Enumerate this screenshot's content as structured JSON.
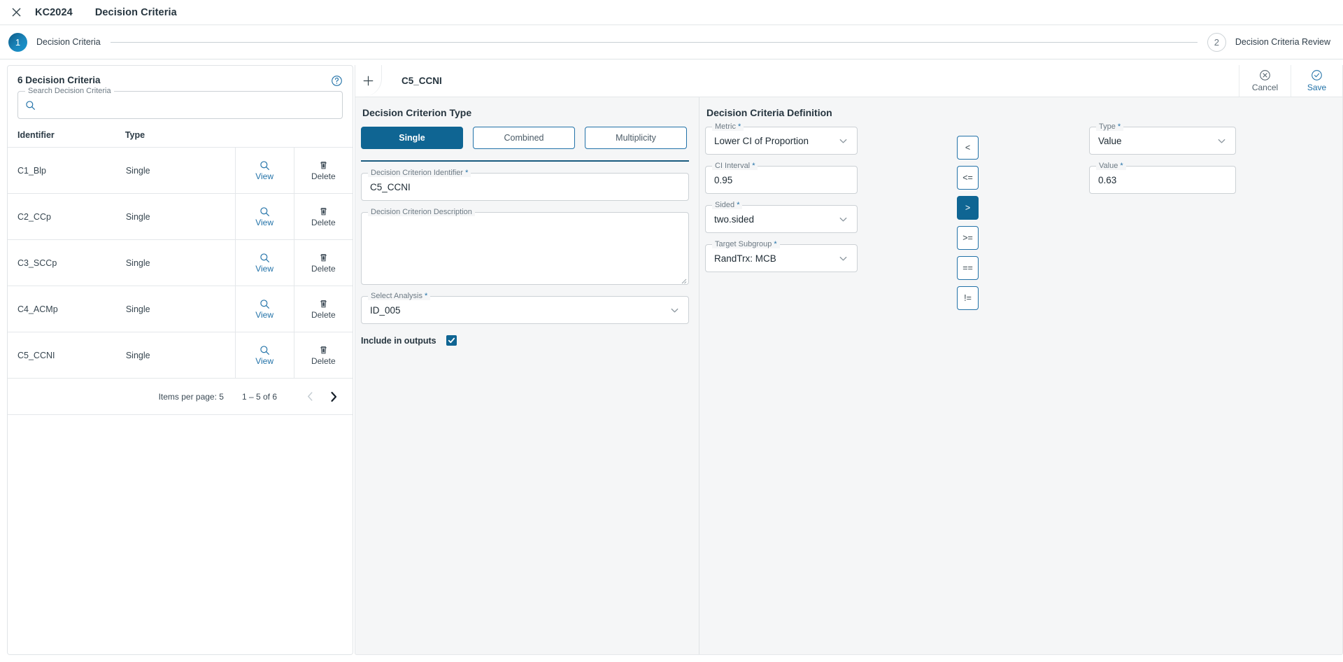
{
  "titlebar": {
    "close_icon": "close-icon",
    "app": "KC2024",
    "page": "Decision Criteria"
  },
  "stepper": {
    "steps": [
      {
        "number": "1",
        "label": "Decision Criteria",
        "active": true
      },
      {
        "number": "2",
        "label": "Decision Criteria Review",
        "active": false
      }
    ]
  },
  "left_panel": {
    "title": "6 Decision Criteria",
    "help_icon": "help-circle-icon",
    "search": {
      "label": "Search Decision Criteria",
      "value": "",
      "icon": "search-icon"
    },
    "columns": [
      "Identifier",
      "Type",
      "",
      ""
    ],
    "rows": [
      {
        "identifier": "C1_Blp",
        "type": "Single",
        "view": "View",
        "delete": "Delete"
      },
      {
        "identifier": "C2_CCp",
        "type": "Single",
        "view": "View",
        "delete": "Delete"
      },
      {
        "identifier": "C3_SCCp",
        "type": "Single",
        "view": "View",
        "delete": "Delete"
      },
      {
        "identifier": "C4_ACMp",
        "type": "Single",
        "view": "View",
        "delete": "Delete"
      },
      {
        "identifier": "C5_CCNI",
        "type": "Single",
        "view": "View",
        "delete": "Delete"
      }
    ],
    "paginator": {
      "items_per_page": "Items per page: 5",
      "range": "1 – 5 of 6",
      "prev_icon": "chevron-left-icon",
      "next_icon": "chevron-right-icon"
    }
  },
  "main": {
    "add_icon": "plus-icon",
    "title": "C5_CCNI",
    "cancel": {
      "label": "Cancel",
      "icon": "cancel-circle-icon"
    },
    "save": {
      "label": "Save",
      "icon": "check-circle-icon"
    },
    "criterion_type": {
      "section_title": "Decision Criterion Type",
      "options": [
        "Single",
        "Combined",
        "Multiplicity"
      ],
      "selected": "Single"
    },
    "identifier_field": {
      "label": "Decision Criterion Identifier",
      "required": "*",
      "value": "C5_CCNI"
    },
    "description_field": {
      "label": "Decision Criterion Description",
      "required": "",
      "value": ""
    },
    "analysis_field": {
      "label": "Select Analysis",
      "required": "*",
      "value": "ID_005"
    },
    "include_outputs": {
      "label": "Include in outputs",
      "checked": true,
      "check_glyph": "✔"
    }
  },
  "definition": {
    "section_title": "Decision Criteria Definition",
    "metric": {
      "label": "Metric",
      "required": "*",
      "value": "Lower CI of Proportion"
    },
    "ci_interval": {
      "label": "CI Interval",
      "required": "*",
      "value": "0.95"
    },
    "sided": {
      "label": "Sided",
      "required": "*",
      "value": "two.sided"
    },
    "target_subgroup": {
      "label": "Target Subgroup",
      "required": "*",
      "value": "RandTrx: MCB"
    },
    "operators": [
      "<",
      "<=",
      ">",
      ">=",
      "==",
      "!="
    ],
    "operator_selected": ">",
    "type": {
      "label": "Type",
      "required": "*",
      "value": "Value"
    },
    "value": {
      "label": "Value",
      "required": "*",
      "value": "0.63"
    }
  },
  "colors": {
    "accent": "#0f6593",
    "accent_link": "#2272a8",
    "text": "#26353f",
    "panel_bg": "#f5f6f7",
    "border": "#e0e4e7"
  }
}
